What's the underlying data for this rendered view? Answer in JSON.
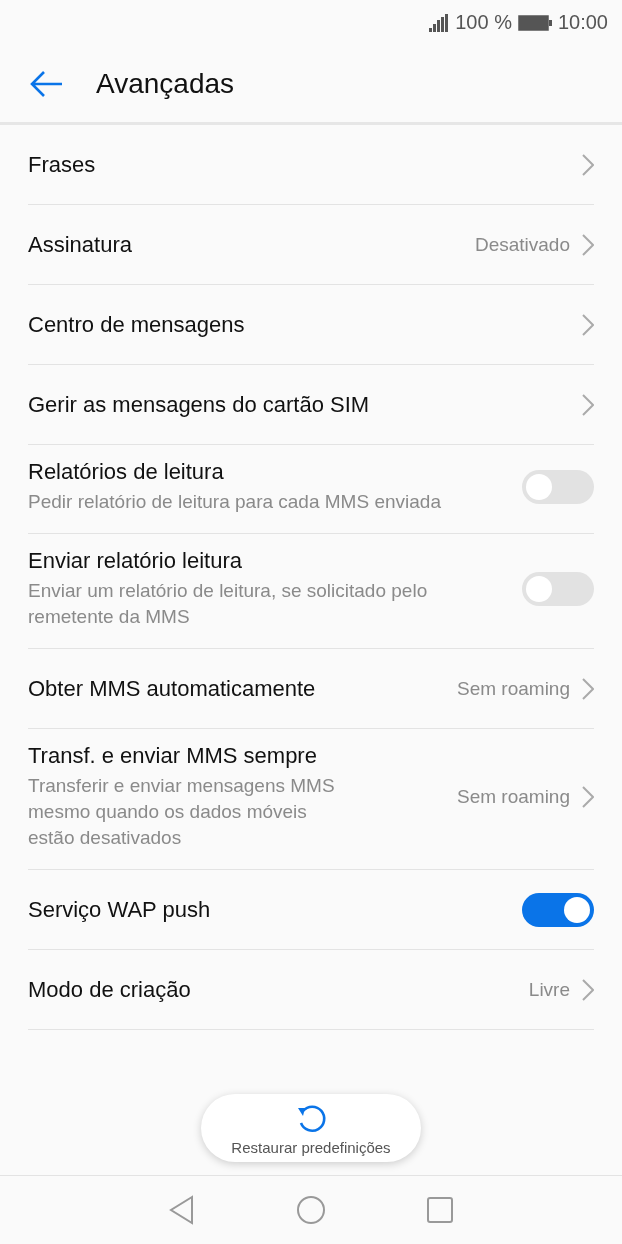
{
  "status_bar": {
    "battery": "100 %",
    "time": "10:00"
  },
  "header": {
    "title": "Avançadas"
  },
  "settings": [
    {
      "kind": "link",
      "title": "Frases"
    },
    {
      "kind": "link",
      "title": "Assinatura",
      "value": "Desativado"
    },
    {
      "kind": "link",
      "title": "Centro de mensagens"
    },
    {
      "kind": "link",
      "title": "Gerir as mensagens do cartão SIM"
    },
    {
      "kind": "toggle",
      "title": "Relatórios de leitura",
      "subtitle": "Pedir relatório de leitura para cada MMS enviada",
      "on": false
    },
    {
      "kind": "toggle",
      "title": "Enviar relatório leitura",
      "subtitle": "Enviar um relatório de leitura, se solicitado pelo remetente da MMS",
      "on": false
    },
    {
      "kind": "link",
      "title": "Obter MMS automaticamente",
      "value": "Sem roaming"
    },
    {
      "kind": "link",
      "title": "Transf. e enviar MMS sempre",
      "subtitle": "Transferir e enviar mensagens MMS mesmo quando os dados móveis estão desativados",
      "value": "Sem roaming"
    },
    {
      "kind": "toggle",
      "title": "Serviço WAP push",
      "on": true
    },
    {
      "kind": "link",
      "title": "Modo de criação",
      "value": "Livre"
    }
  ],
  "restore_button": {
    "label": "Restaurar predefinições"
  }
}
